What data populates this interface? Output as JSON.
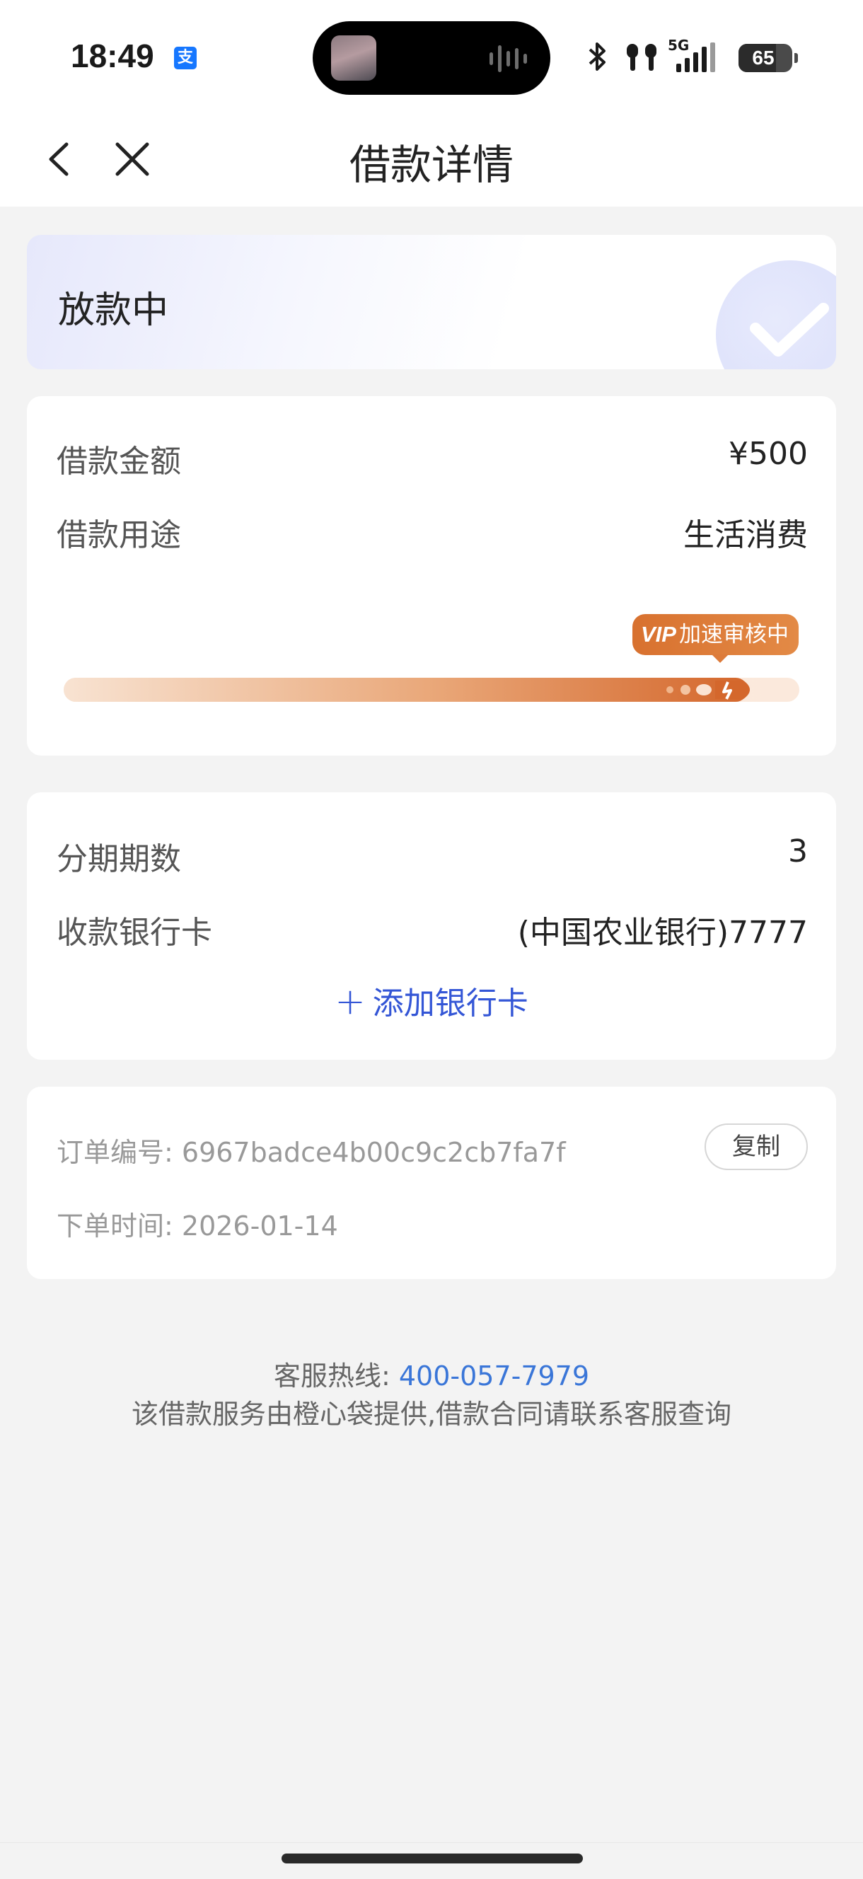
{
  "status_bar": {
    "time": "18:49",
    "alipay_badge": "支",
    "network": "5G",
    "battery": "65"
  },
  "nav": {
    "title": "借款详情"
  },
  "status": {
    "text": "放款中"
  },
  "loan": {
    "amount_label": "借款金额",
    "amount_value": "¥500",
    "purpose_label": "借款用途",
    "purpose_value": "生活消费",
    "progress_fraction": 0.93,
    "badge_vip": "VIP",
    "badge_text": "加速审核中"
  },
  "repayment": {
    "periods_label": "分期期数",
    "periods_value": "3",
    "bank_label": "收款银行卡",
    "bank_value": "(中国农业银行)7777",
    "add_bank_plus": "+",
    "add_bank_label": "添加银行卡"
  },
  "order": {
    "id_label": "订单编号:",
    "id_value": "6967badce4b00c9c2cb7fa7f",
    "copy_label": "复制",
    "time_label": "下单时间:",
    "time_value": "2026-01-14"
  },
  "footer": {
    "hotline_label": "客服热线:",
    "hotline_number": "400-057-7979",
    "notice": "该借款服务由橙心袋提供,借款合同请联系客服查询"
  },
  "colors": {
    "accent_blue": "#3456d6",
    "link_blue": "#3a76d8",
    "progress_orange": "#d4672c"
  },
  "icons": [
    "back-arrow-icon",
    "close-icon",
    "check-icon",
    "rocket-icon",
    "bluetooth-icon",
    "earbuds-icon",
    "signal-icon",
    "battery-icon",
    "voice-wave-icon",
    "alipay-icon"
  ]
}
